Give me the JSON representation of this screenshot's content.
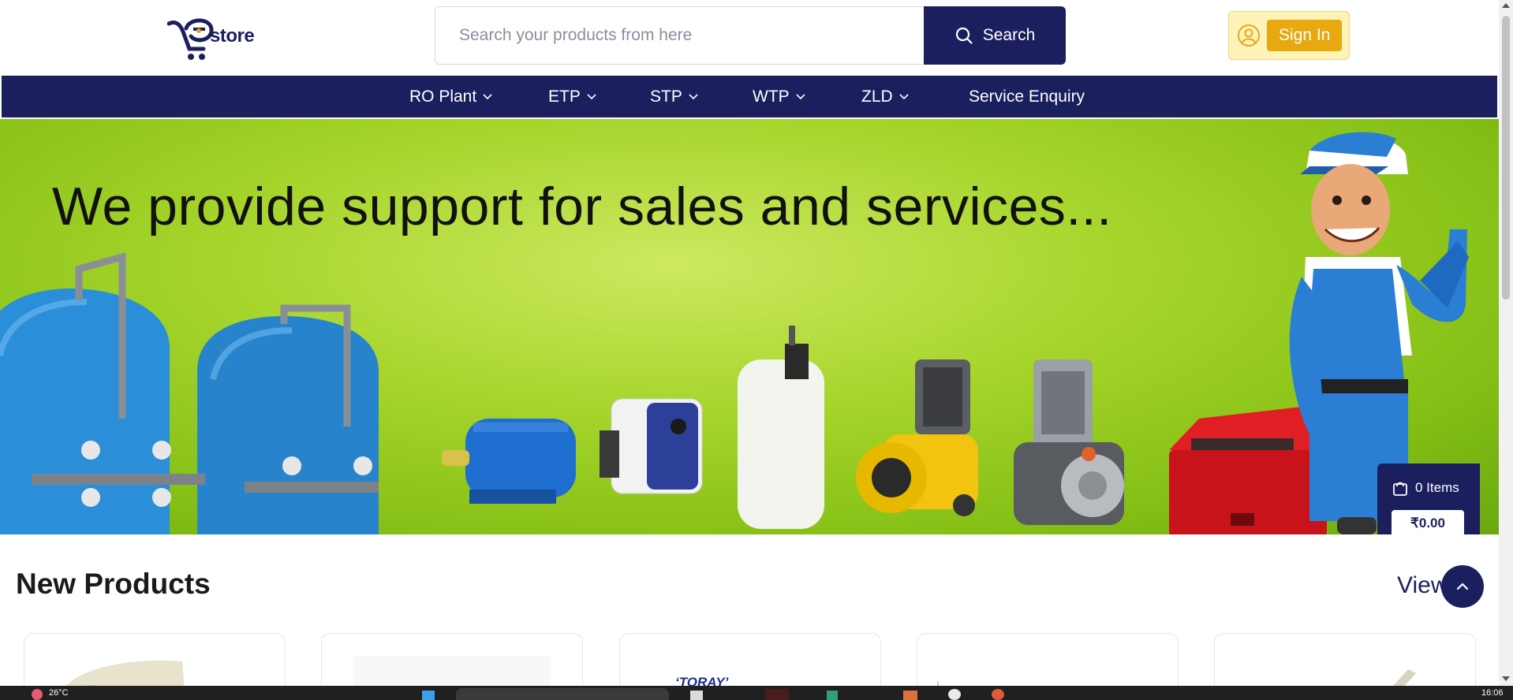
{
  "header": {
    "logo_text": "store",
    "search_placeholder": "Search your products from here",
    "search_label": "Search",
    "signin_label": "Sign In"
  },
  "nav": {
    "items": [
      {
        "label": "RO Plant",
        "dropdown": true
      },
      {
        "label": "ETP",
        "dropdown": true
      },
      {
        "label": "STP",
        "dropdown": true
      },
      {
        "label": "WTP",
        "dropdown": true
      },
      {
        "label": "ZLD",
        "dropdown": true
      },
      {
        "label": "Service Enquiry",
        "dropdown": false
      }
    ]
  },
  "banner": {
    "headline": "We provide support for sales and services..."
  },
  "cart": {
    "items_label": "0 Items",
    "total": "₹0.00"
  },
  "new_products": {
    "title": "New Products",
    "view_all_label": "View",
    "cards": [
      {
        "brand_text": ""
      },
      {
        "brand_text": ""
      },
      {
        "brand_text": "‘TORAY’"
      },
      {
        "brand_text": ""
      },
      {
        "brand_text": ""
      }
    ]
  },
  "taskbar": {
    "weather": "26°C",
    "time": "16:06"
  },
  "colors": {
    "brand_navy": "#1c1f5e",
    "accent_yellow": "#e7a810",
    "banner_green": "#a5d42a"
  }
}
